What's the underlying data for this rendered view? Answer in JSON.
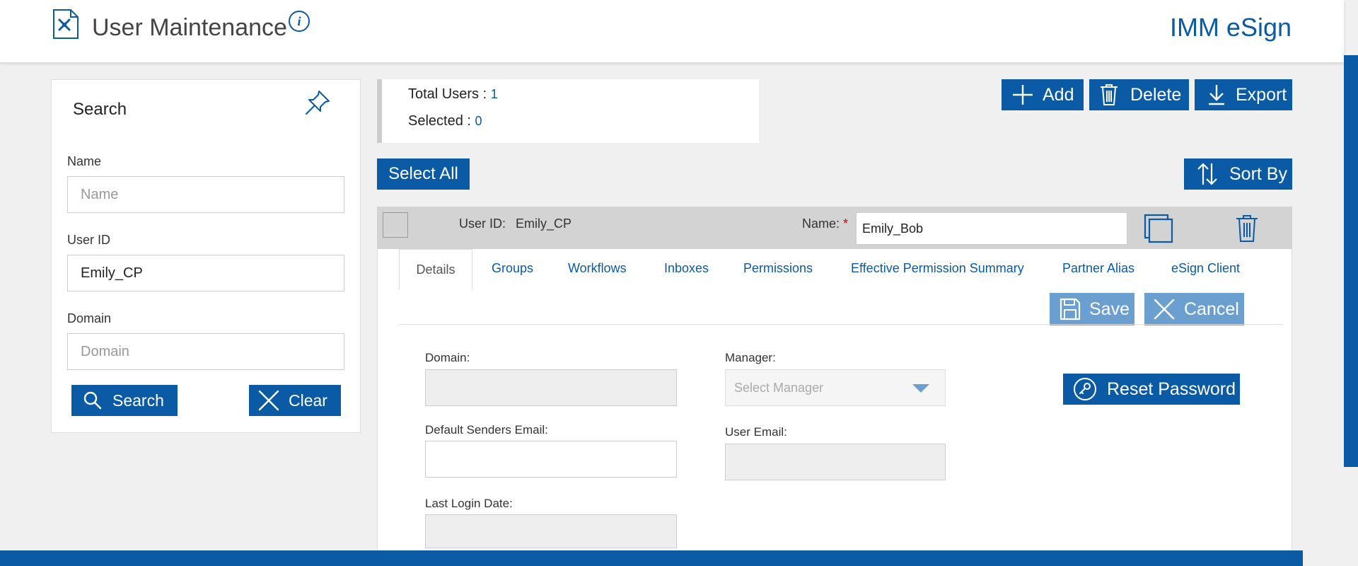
{
  "header": {
    "title": "User Maintenance",
    "info_icon_text": "i",
    "brand": "IMM eSign"
  },
  "search": {
    "title": "Search",
    "name_label": "Name",
    "name_placeholder": "Name",
    "name_value": "",
    "userid_label": "User ID",
    "userid_value": "Emily_CP",
    "domain_label": "Domain",
    "domain_placeholder": "Domain",
    "domain_value": "",
    "search_button": "Search",
    "clear_button": "Clear"
  },
  "counts": {
    "total_label": "Total Users : ",
    "total_value": "1",
    "selected_label": "Selected : ",
    "selected_value": "0"
  },
  "toolbar": {
    "add_label": "Add",
    "delete_label": "Delete",
    "export_label": "Export",
    "select_all_label": "Select All",
    "sort_by_label": "Sort By"
  },
  "user": {
    "userid_label": "User ID:",
    "userid_value": "Emily_CP",
    "name_label": "Name:",
    "name_required": "*",
    "name_value": "Emily_Bob"
  },
  "tabs": [
    {
      "label": "Details",
      "active": true
    },
    {
      "label": "Groups"
    },
    {
      "label": "Workflows"
    },
    {
      "label": "Inboxes"
    },
    {
      "label": "Permissions"
    },
    {
      "label": "Effective Permission Summary"
    },
    {
      "label": "Partner Alias"
    },
    {
      "label": "eSign Client"
    }
  ],
  "details": {
    "save_label": "Save",
    "cancel_label": "Cancel",
    "domain_label": "Domain:",
    "manager_label": "Manager:",
    "manager_placeholder": "Select Manager",
    "reset_password_label": "Reset Password",
    "default_senders_email_label": "Default Senders Email:",
    "user_email_label": "User Email:",
    "last_login_label": "Last Login Date:"
  },
  "colors": {
    "primary": "#0a5aa6",
    "primary_light": "#6a9fd0",
    "header_strip": "#d3d3d3",
    "background": "#f0f0f0"
  }
}
